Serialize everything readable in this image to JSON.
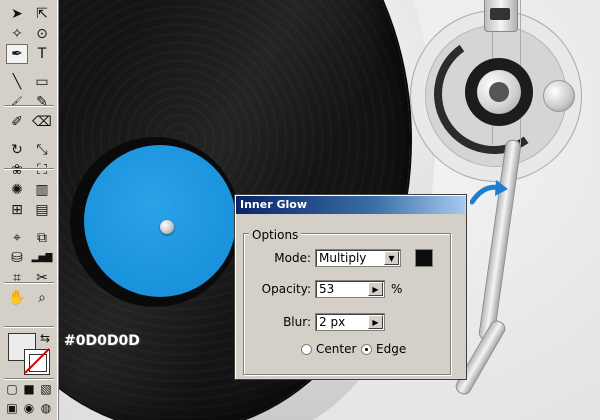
{
  "artwork": {
    "swatch_hex_label": "#0D0D0D",
    "record_label_color": "#1b94de",
    "record_color": "#141414",
    "arrow_color": "#1a7fd0"
  },
  "toolbox": {
    "tools": [
      {
        "name": "selection-tool-icon",
        "glyph": "➤"
      },
      {
        "name": "direct-selection-tool-icon",
        "glyph": "⇱"
      },
      {
        "name": "magic-wand-tool-icon",
        "glyph": "✧"
      },
      {
        "name": "lasso-tool-icon",
        "glyph": "⊙"
      },
      {
        "name": "pen-tool-icon",
        "glyph": "✒"
      },
      {
        "name": "type-tool-icon",
        "glyph": "T"
      },
      {
        "name": "line-segment-tool-icon",
        "glyph": "╲"
      },
      {
        "name": "rectangle-tool-icon",
        "glyph": "▭"
      },
      {
        "name": "paintbrush-tool-icon",
        "glyph": "🖌"
      },
      {
        "name": "pencil-tool-icon",
        "glyph": "✎"
      },
      {
        "name": "blob-brush-tool-icon",
        "glyph": "✐"
      },
      {
        "name": "eraser-tool-icon",
        "glyph": "⌫"
      },
      {
        "name": "rotate-tool-icon",
        "glyph": "↻"
      },
      {
        "name": "scale-tool-icon",
        "glyph": "⤡"
      },
      {
        "name": "warp-tool-icon",
        "glyph": "❀"
      },
      {
        "name": "free-transform-tool-icon",
        "glyph": "⛶"
      },
      {
        "name": "symbol-sprayer-tool-icon",
        "glyph": "✺"
      },
      {
        "name": "column-graph-tool-icon",
        "glyph": "▥"
      },
      {
        "name": "mesh-tool-icon",
        "glyph": "⊞"
      },
      {
        "name": "gradient-tool-icon",
        "glyph": "▤"
      },
      {
        "name": "eyedropper-tool-icon",
        "glyph": "⌖"
      },
      {
        "name": "blend-tool-icon",
        "glyph": "⧉"
      },
      {
        "name": "live-paint-bucket-tool-icon",
        "glyph": "⛁"
      },
      {
        "name": "bar-graph-tool-icon",
        "glyph": "▂▅▇"
      },
      {
        "name": "artboard-tool-icon",
        "glyph": "⌗"
      },
      {
        "name": "slice-tool-icon",
        "glyph": "✂"
      },
      {
        "name": "hand-tool-icon",
        "glyph": "✋"
      },
      {
        "name": "zoom-tool-icon",
        "glyph": "⌕"
      }
    ],
    "swap_icon_glyph": "⇆",
    "mode_glyphs": [
      "▢",
      "■",
      "▧"
    ],
    "screen_glyphs": [
      "▣",
      "◉",
      "◍"
    ]
  },
  "dialog": {
    "title": "Inner Glow",
    "options_label": "Options",
    "mode_label": "Mode:",
    "mode_value": "Multiply",
    "glow_color": "#0d0d0d",
    "opacity_label": "Opacity:",
    "opacity_value": "53",
    "opacity_unit": "%",
    "blur_label": "Blur:",
    "blur_value": "2 px",
    "center_label": "Center",
    "edge_label": "Edge",
    "selected_source": "Edge"
  }
}
